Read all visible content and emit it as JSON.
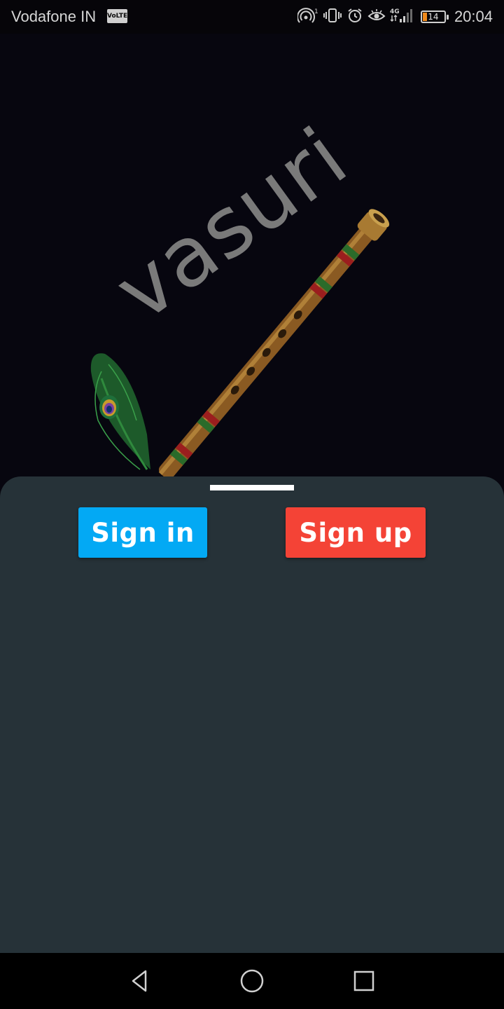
{
  "status_bar": {
    "carrier": "Vodafone IN",
    "volte_badge": "VoLTE",
    "network": "4G",
    "battery_level": "14",
    "time": "20:04",
    "icons": [
      "hotspot-icon",
      "vibrate-icon",
      "alarm-icon",
      "eye-comfort-icon",
      "signal-4g-icon",
      "battery-icon"
    ]
  },
  "logo": {
    "wordmark": "vasuri",
    "icon": "flute-with-peacock-feather"
  },
  "sheet": {
    "sign_in_label": "Sign in",
    "sign_up_label": "Sign up"
  },
  "colors": {
    "background": "#07060f",
    "sheet": "#263238",
    "sign_in": "#03a9f4",
    "sign_up": "#f44336",
    "handle": "#ffffff"
  },
  "nav_bar": {
    "icons": [
      "back-icon",
      "home-icon",
      "recents-icon"
    ]
  }
}
